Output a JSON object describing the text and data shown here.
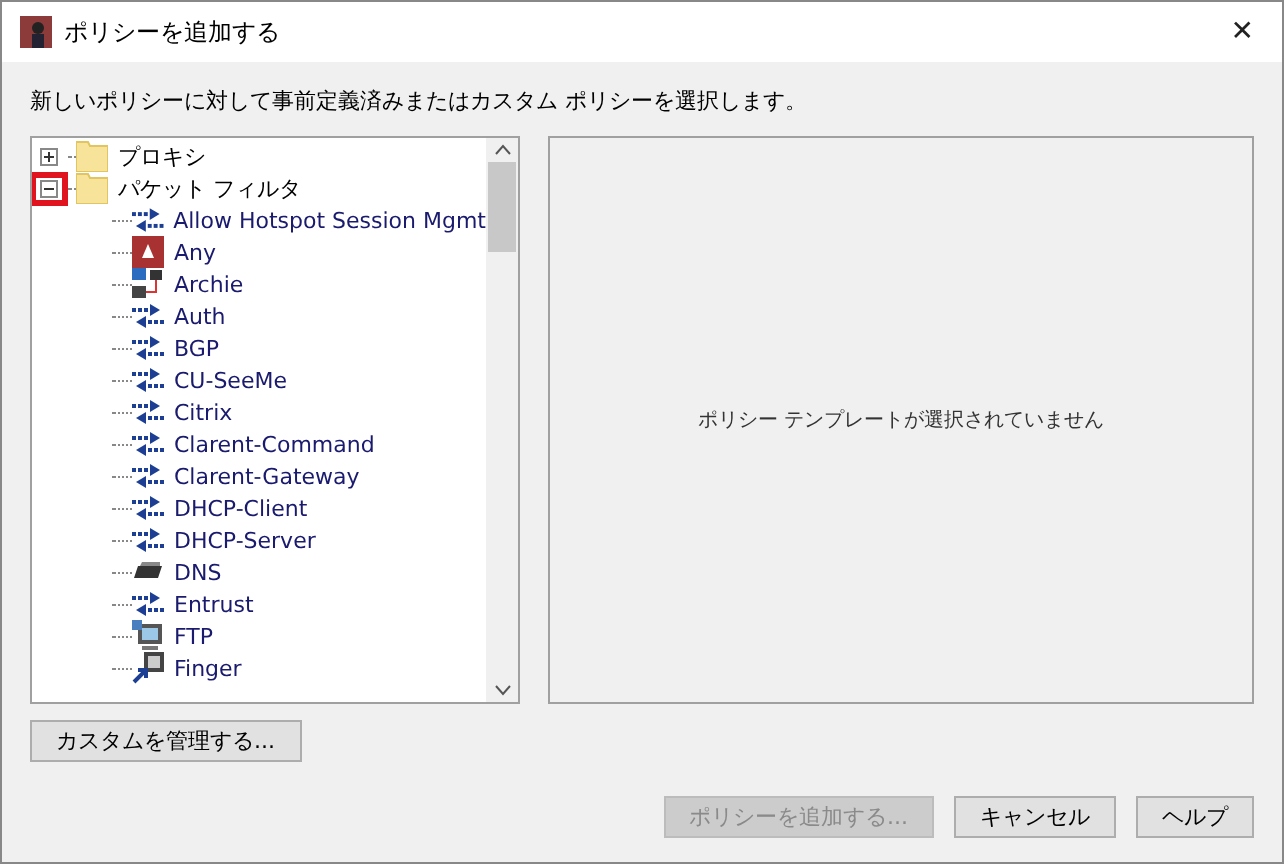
{
  "window": {
    "title": "ポリシーを追加する",
    "close": "✕"
  },
  "instruction": "新しいポリシーに対して事前定義済みまたはカスタム ポリシーを選択します。",
  "tree": [
    {
      "label": "プロキシ",
      "expanded": false,
      "highlighted": false
    },
    {
      "label": "パケット フィルタ",
      "expanded": true,
      "highlighted": true,
      "children": [
        {
          "label": "Allow Hotspot Session Mgmt",
          "kind": "arrows"
        },
        {
          "label": "Any",
          "kind": "any"
        },
        {
          "label": "Archie",
          "kind": "network"
        },
        {
          "label": "Auth",
          "kind": "arrows"
        },
        {
          "label": "BGP",
          "kind": "arrows"
        },
        {
          "label": "CU-SeeMe",
          "kind": "arrows"
        },
        {
          "label": "Citrix",
          "kind": "arrows"
        },
        {
          "label": "Clarent-Command",
          "kind": "arrows"
        },
        {
          "label": "Clarent-Gateway",
          "kind": "arrows"
        },
        {
          "label": "DHCP-Client",
          "kind": "arrows"
        },
        {
          "label": "DHCP-Server",
          "kind": "arrows"
        },
        {
          "label": "DNS",
          "kind": "tray"
        },
        {
          "label": "Entrust",
          "kind": "arrows"
        },
        {
          "label": "FTP",
          "kind": "monitor"
        },
        {
          "label": "Finger",
          "kind": "finger"
        }
      ]
    }
  ],
  "preview_message": "ポリシー テンプレートが選択されていません",
  "manage_button": "カスタムを管理する...",
  "buttons": [
    {
      "label": "ポリシーを追加する...",
      "disabled": true
    },
    {
      "label": "キャンセル",
      "disabled": false
    },
    {
      "label": "ヘルプ",
      "disabled": false
    }
  ]
}
